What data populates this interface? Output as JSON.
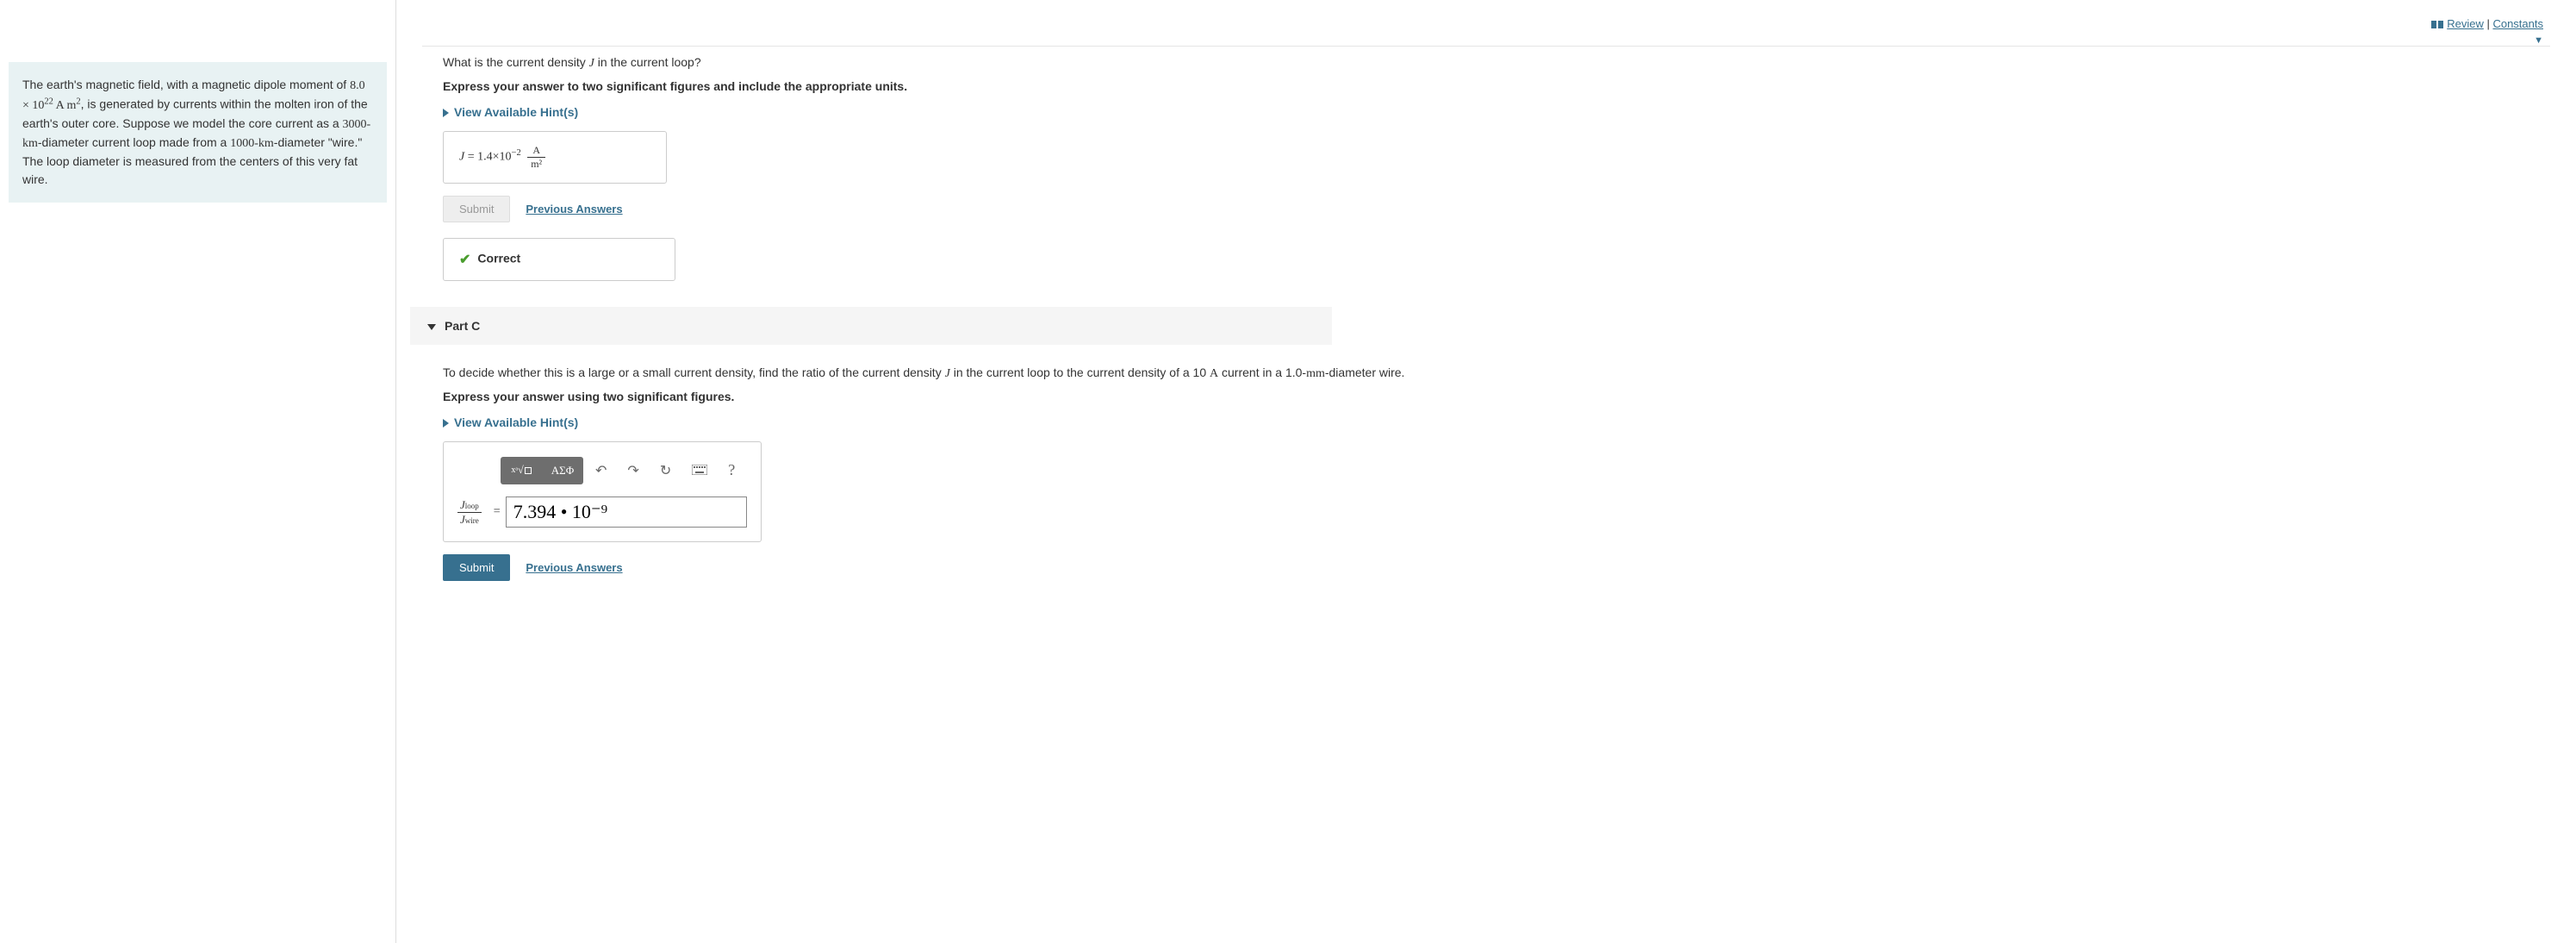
{
  "top_links": {
    "review": "Review",
    "sep": " | ",
    "constants": "Constants"
  },
  "problem": {
    "line1": "The earth's magnetic field, with a magnetic dipole moment of ",
    "moment_val": "8.0 × 10",
    "moment_exp": "22",
    "moment_unit1": " A m",
    "moment_unit_exp": "2",
    "line2": ", is generated by currents within the molten iron of the earth's outer core. Suppose we model the core current as a ",
    "loop_diam": "3000-km",
    "line3": "-diameter current loop made from a ",
    "wire_diam": "1000-km",
    "line4": "-diameter \"wire.\" The loop diameter is measured from the centers of this very fat wire."
  },
  "partB": {
    "question_pre": "What is the current density ",
    "question_var": "J",
    "question_post": " in the current loop?",
    "instruction": "Express your answer to two significant figures and include the appropriate units.",
    "hints": "View Available Hint(s)",
    "ans_var": "J",
    "ans_eq": " = ",
    "ans_val": "1.4×10",
    "ans_exp": "−2",
    "ans_unit_top": "A",
    "ans_unit_bot": "m²",
    "submit": "Submit",
    "prev": "Previous Answers",
    "correct": "Correct"
  },
  "partC": {
    "header": "Part C",
    "q1": "To decide whether this is a large or a small current density, find the ratio of the current density ",
    "qvar": "J",
    "q2": " in the current loop to the current density of a 10 ",
    "qunit": "A",
    "q3": " current in a 1.0-",
    "qunit2": "mm",
    "q4": "-diameter wire.",
    "instruction": "Express your answer using two significant figures.",
    "hints": "View Available Hint(s)",
    "toolbar": {
      "templates": "x√□",
      "greek": "ΑΣΦ",
      "undo": "↶",
      "redo": "↷",
      "reset": "↻",
      "keyboard": "⌨",
      "help": "?"
    },
    "ratio_top_var": "J",
    "ratio_top_sub": "loop",
    "ratio_bot_var": "J",
    "ratio_bot_sub": "wire",
    "input_value": "7.394 • 10⁻⁹",
    "submit": "Submit",
    "prev": "Previous Answers"
  }
}
